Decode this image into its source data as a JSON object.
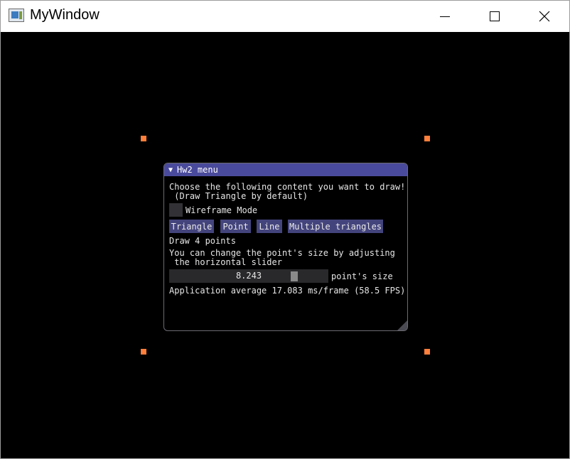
{
  "window": {
    "title": "MyWindow",
    "controls": [
      "minimize",
      "maximize",
      "close"
    ]
  },
  "canvas": {
    "background": "#000000",
    "point_color": "#ff7f3c",
    "points_count_shown": 4
  },
  "imgui": {
    "title": "Hw2 menu",
    "collapse_icon": "▼",
    "prompt_line1": "Choose the following content you want to draw!",
    "prompt_line2": " (Draw Triangle by default)",
    "wireframe_label": "Wireframe Mode",
    "wireframe_checked": false,
    "buttons": {
      "triangle": "Triangle",
      "point": "Point",
      "line": "Line",
      "multiple": "Multiple triangles"
    },
    "status": "Draw 4 points",
    "hint_line1": "You can change the point's size by adjusting",
    "hint_line2": " the horizontal slider",
    "slider_value": "8.243",
    "slider_label": "point's size",
    "fps_text": "Application average 17.083 ms/frame (58.5 FPS)",
    "colors": {
      "title_bg": "#4a4a9c",
      "button_bg": "#44447d",
      "frame_bg": "#29292c"
    }
  }
}
